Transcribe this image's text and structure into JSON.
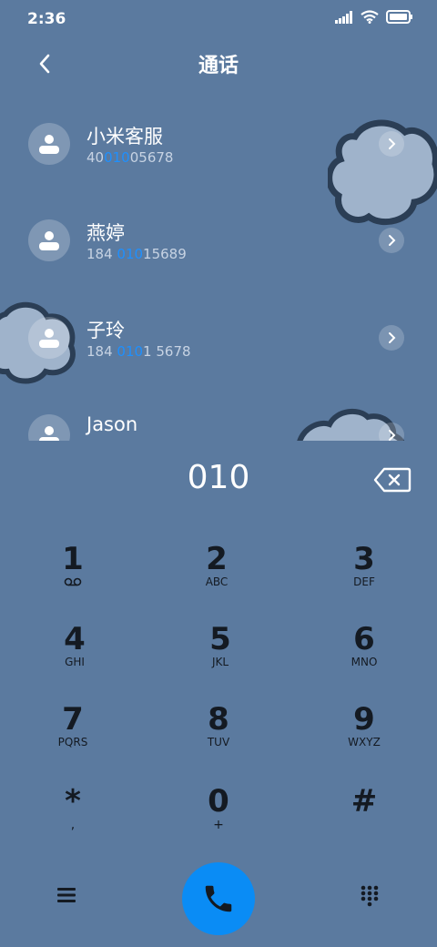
{
  "status_bar": {
    "time": "2:36"
  },
  "header": {
    "title": "通话"
  },
  "contacts": [
    {
      "name": "小米客服",
      "num_pre": "40",
      "num_hl": "010",
      "num_post": "05678"
    },
    {
      "name": "燕婷",
      "num_pre": "184 ",
      "num_hl": "010",
      "num_post": "15689"
    },
    {
      "name": "子玲",
      "num_pre": "184 ",
      "num_hl": "010",
      "num_post": "1 5678"
    },
    {
      "name": "Jason",
      "num_pre": "",
      "num_hl": "",
      "num_post": ""
    }
  ],
  "dialer": {
    "input": "010",
    "keys": [
      {
        "digit": "1",
        "sub": ""
      },
      {
        "digit": "2",
        "sub": "ABC"
      },
      {
        "digit": "3",
        "sub": "DEF"
      },
      {
        "digit": "4",
        "sub": "GHI"
      },
      {
        "digit": "5",
        "sub": "JKL"
      },
      {
        "digit": "6",
        "sub": "MNO"
      },
      {
        "digit": "7",
        "sub": "PQRS"
      },
      {
        "digit": "8",
        "sub": "TUV"
      },
      {
        "digit": "9",
        "sub": "WXYZ"
      },
      {
        "digit": "*",
        "sub": ","
      },
      {
        "digit": "0",
        "sub": "+"
      },
      {
        "digit": "#",
        "sub": ""
      }
    ]
  },
  "colors": {
    "background": "#5b7a9f",
    "accent": "#0a8cf5",
    "highlight": "#1e90ff"
  },
  "icons": {
    "status": [
      "signal-icon",
      "wifi-icon",
      "battery-icon"
    ],
    "header": "back-arrow-icon",
    "voicemail": "voicemail-icon",
    "bottom": [
      "menu-icon",
      "phone-icon",
      "keypad-icon"
    ]
  }
}
